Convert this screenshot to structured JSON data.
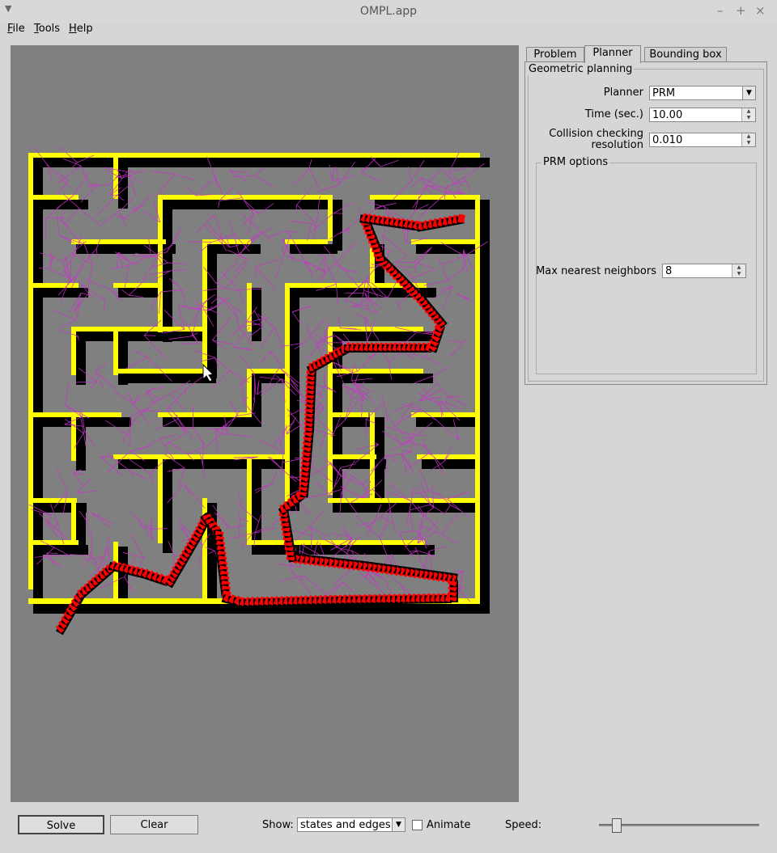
{
  "window": {
    "title": "OMPL.app"
  },
  "menu": [
    {
      "label": "File",
      "mnemonic": "F",
      "rest": "ile"
    },
    {
      "label": "Tools",
      "mnemonic": "T",
      "rest": "ools"
    },
    {
      "label": "Help",
      "mnemonic": "H",
      "rest": "elp"
    }
  ],
  "tabs": [
    {
      "label": "Problem",
      "active": false
    },
    {
      "label": "Planner",
      "active": true
    },
    {
      "label": "Bounding box",
      "active": false
    }
  ],
  "planning": {
    "group_title": "Geometric planning",
    "planner_label": "Planner",
    "planner_value": "PRM",
    "time_label": "Time (sec.)",
    "time_value": "10.00",
    "collision_label_line1": "Collision checking",
    "collision_label_line2": "resolution",
    "collision_value": "0.010",
    "prm_title": "PRM options",
    "neighbors_label": "Max nearest neighbors",
    "neighbors_value": "8"
  },
  "bottom": {
    "solve_label": "Solve",
    "clear_label": "Clear",
    "show_label": "Show:",
    "show_value": "states and edges",
    "animate_label": "Animate",
    "animate_checked": false,
    "speed_label": "Speed:",
    "speed_fraction": 0.08
  },
  "colors": {
    "maze_wall": "#ffff00",
    "path": "#ff0000",
    "graph_edges": "#cc33cc",
    "background": "#808080"
  }
}
